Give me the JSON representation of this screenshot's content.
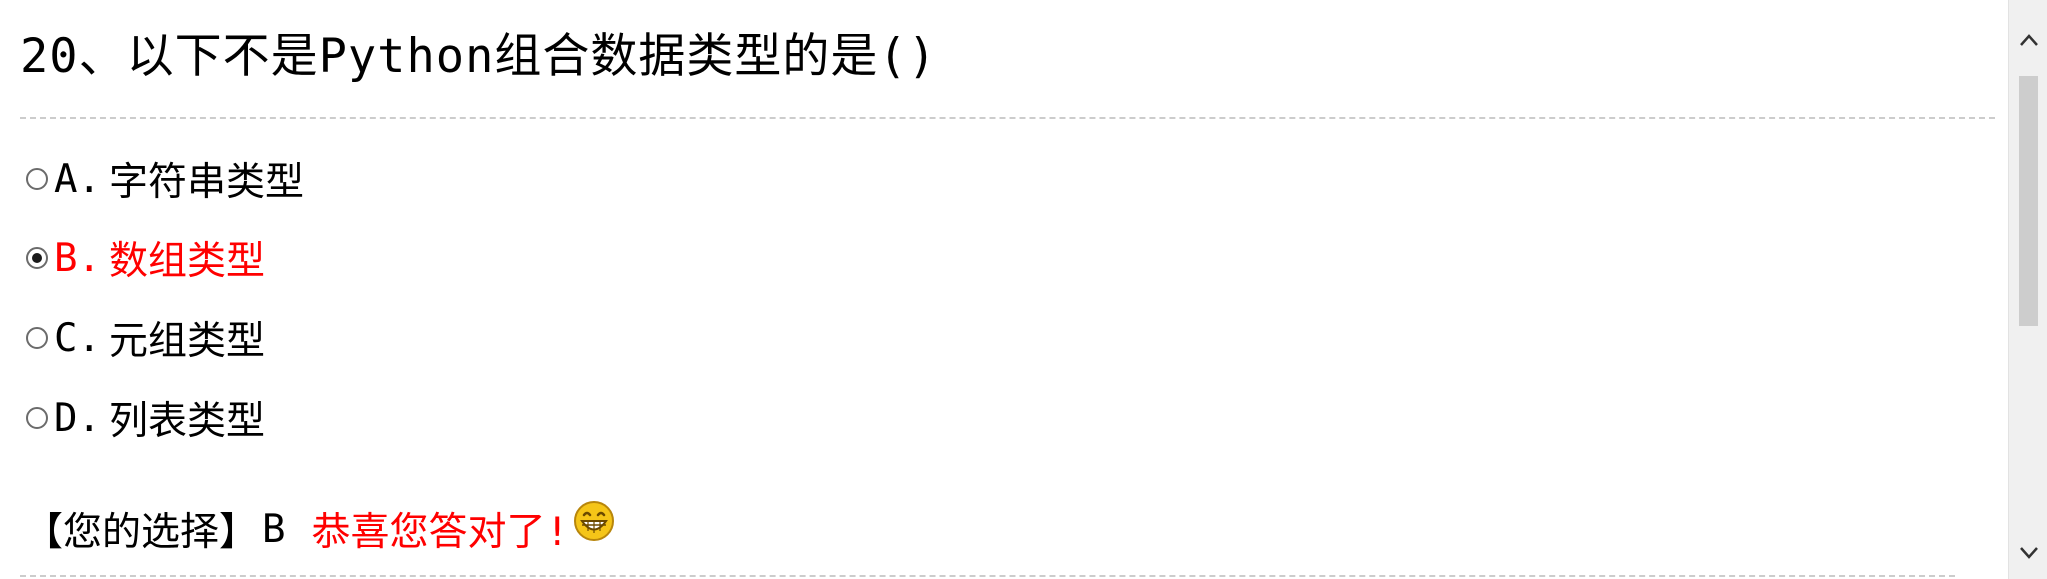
{
  "question": {
    "title": "20、以下不是Python组合数据类型的是()"
  },
  "options": [
    {
      "letter": "A.",
      "text": "字符串类型",
      "checked": false
    },
    {
      "letter": "B.",
      "text": "数组类型",
      "checked": true
    },
    {
      "letter": "C.",
      "text": "元组类型",
      "checked": false
    },
    {
      "letter": "D.",
      "text": "列表类型",
      "checked": false
    }
  ],
  "result": {
    "label": "【您的选择】",
    "answer": "B",
    "message": "恭喜您答对了!",
    "icon": "grin-smiley-icon"
  },
  "colors": {
    "selected": "#ff0000",
    "message": "#ff0000",
    "divider": "#cccccc",
    "scrollbar_track": "#f0f0f0",
    "scrollbar_thumb": "#cdcdcd",
    "smiley_face": "#f5c518"
  }
}
